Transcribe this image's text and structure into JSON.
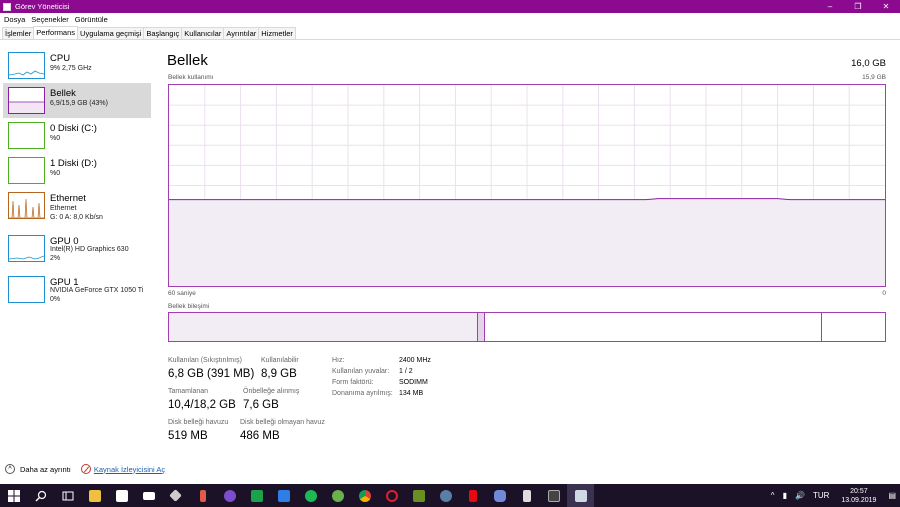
{
  "window": {
    "title": "Görev Yöneticisi"
  },
  "menu": [
    "Dosya",
    "Seçenekler",
    "Görüntüle"
  ],
  "tabs": [
    "İşlemler",
    "Performans",
    "Uygulama geçmişi",
    "Başlangıç",
    "Kullanıcılar",
    "Ayrıntılar",
    "Hizmetler"
  ],
  "sidebar": {
    "items": [
      {
        "title": "CPU",
        "lines": [
          "9% 2,75 GHz"
        ],
        "color": "#1f8fd3"
      },
      {
        "title": "Bellek",
        "lines": [
          "6,9/15,9 GB (43%)"
        ],
        "color": "#8b1fa8",
        "selected": true
      },
      {
        "title": "0 Diski (C:)",
        "lines": [
          "%0"
        ],
        "color": "#4caf22"
      },
      {
        "title": "1 Diski (D:)",
        "lines": [
          "%0"
        ],
        "color": "#4caf22"
      },
      {
        "title": "Ethernet",
        "lines": [
          "Ethernet",
          "G: 0 A: 8,0 Kb/sn"
        ],
        "color": "#b5651d"
      },
      {
        "title": "GPU 0",
        "lines": [
          "Intel(R) HD Graphics 630",
          "2%"
        ],
        "color": "#1f8fd3"
      },
      {
        "title": "GPU 1",
        "lines": [
          "NVIDIA GeForce GTX 1050 Ti",
          "0%"
        ],
        "color": "#1f8fd3"
      }
    ]
  },
  "main": {
    "title": "Bellek",
    "total": "16,0 GB",
    "usage_label": "Bellek kullanımı",
    "usage_max": "15,9 GB",
    "axis_left": "60 saniye",
    "axis_right": "0",
    "composition_label": "Bellek bileşimi",
    "usage_percent": 43,
    "composition": {
      "in_use_fraction": 0.43,
      "modified_fraction": 0.01,
      "standby_fraction": 0.47
    },
    "stats": {
      "in_use_label": "Kullanılan (Sıkıştırılmış)",
      "in_use_value": "6,8 GB (391 MB)",
      "available_label": "Kullanılabilir",
      "available_value": "8,9 GB",
      "committed_label": "Tamamlanan",
      "committed_value": "10,4/18,2 GB",
      "cached_label": "Önbelleğe alınmış",
      "cached_value": "7,6 GB",
      "paged_label": "Disk belleği havuzu",
      "paged_value": "519 MB",
      "nonpaged_label": "Disk belleği olmayan havuz",
      "nonpaged_value": "486 MB"
    },
    "details": {
      "speed_label": "Hız:",
      "speed_value": "2400 MHz",
      "slots_label": "Kullanılan yuvalar:",
      "slots_value": "1 / 2",
      "form_label": "Form faktörü:",
      "form_value": "SODIMM",
      "reserved_label": "Donanıma ayrılmış:",
      "reserved_value": "134 MB"
    }
  },
  "footer": {
    "fewer_details": "Daha az ayrıntı",
    "resource_monitor": "Kaynak İzleyicisini Aç"
  },
  "taskbar": {
    "tray": {
      "language": "TUR",
      "time": "20:57",
      "date": "13.09.2019"
    },
    "apps": [
      "start-icon",
      "search-icon",
      "task-view-icon",
      "file-explorer-icon",
      "store-icon",
      "mail-icon",
      "app-icon",
      "paint-icon",
      "maps-icon",
      "whatsapp-icon",
      "todo-icon",
      "spotify-icon",
      "xbox-icon",
      "chrome-icon",
      "opera-icon",
      "game-icon",
      "steam-icon",
      "netflix-icon",
      "discord-icon",
      "code-icon",
      "terminal-icon",
      "task-manager-icon"
    ]
  }
}
